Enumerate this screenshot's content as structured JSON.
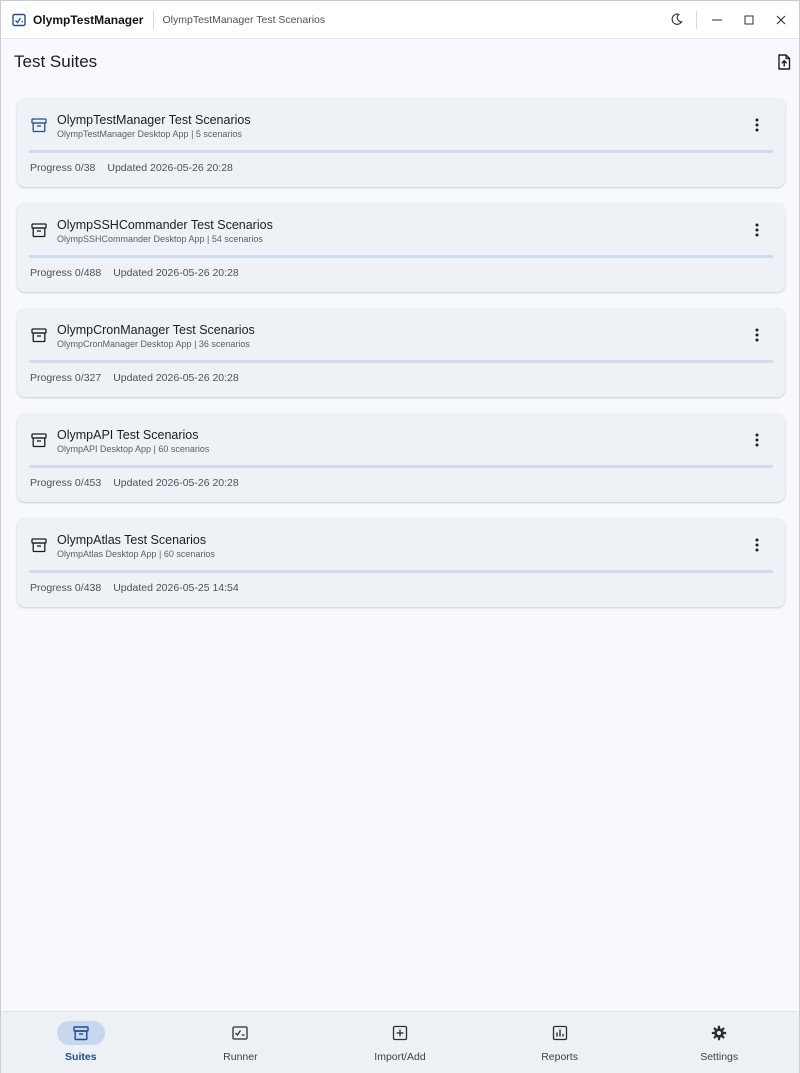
{
  "window": {
    "app_name": "OlympTestManager",
    "subtitle": "OlympTestManager Test Scenarios"
  },
  "header": {
    "title": "Test Suites"
  },
  "suites": [
    {
      "title": "OlympTestManager Test Scenarios",
      "subtitle": "OlympTestManager Desktop App | 5 scenarios",
      "progress": "Progress 0/38",
      "updated": "Updated 2026-05-26 20:28",
      "progress_fraction": 0
    },
    {
      "title": "OlympSSHCommander Test Scenarios",
      "subtitle": "OlympSSHCommander Desktop App | 54 scenarios",
      "progress": "Progress 0/488",
      "updated": "Updated 2026-05-26 20:28",
      "progress_fraction": 0
    },
    {
      "title": "OlympCronManager Test Scenarios",
      "subtitle": "OlympCronManager Desktop App | 36 scenarios",
      "progress": "Progress 0/327",
      "updated": "Updated 2026-05-26 20:28",
      "progress_fraction": 0
    },
    {
      "title": "OlympAPI Test Scenarios",
      "subtitle": "OlympAPI Desktop App | 60 scenarios",
      "progress": "Progress 0/453",
      "updated": "Updated 2026-05-26 20:28",
      "progress_fraction": 0
    },
    {
      "title": "OlympAtlas Test Scenarios",
      "subtitle": "OlympAtlas Desktop App | 60 scenarios",
      "progress": "Progress 0/438",
      "updated": "Updated 2026-05-25 14:54",
      "progress_fraction": 0
    }
  ],
  "nav": {
    "items": [
      {
        "label": "Suites",
        "icon": "archive-icon",
        "active": true
      },
      {
        "label": "Runner",
        "icon": "checklist-icon",
        "active": false
      },
      {
        "label": "Import/Add",
        "icon": "add-box-icon",
        "active": false
      },
      {
        "label": "Reports",
        "icon": "bar-chart-icon",
        "active": false
      },
      {
        "label": "Settings",
        "icon": "gear-icon",
        "active": false
      }
    ]
  },
  "colors": {
    "accent": "#1e4f8f",
    "card_bg": "#eef1f5",
    "progress_track": "#cfdcef",
    "nav_active_pill": "#c6d7ee"
  }
}
